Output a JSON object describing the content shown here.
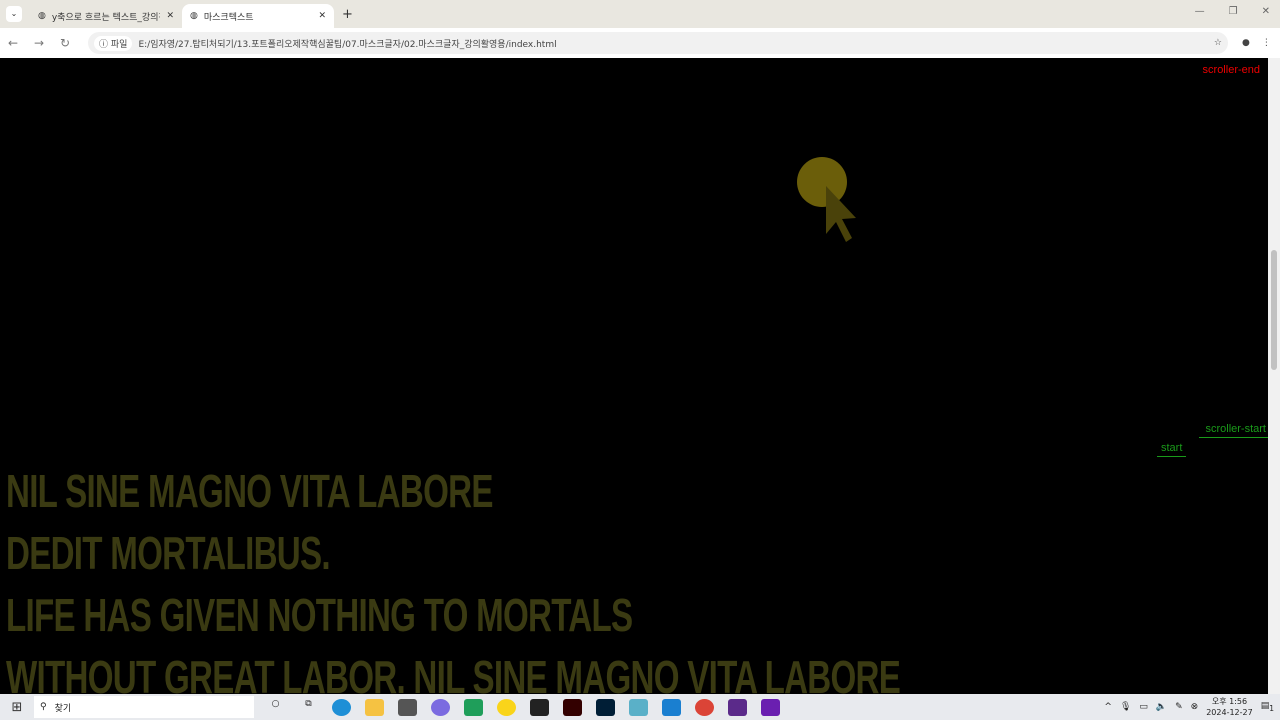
{
  "browser": {
    "tabs": [
      {
        "title": "y축으로 흐르는 텍스트_강의진"
      },
      {
        "title": "마스크텍스트"
      }
    ],
    "url_chip": "파일",
    "url": "E:/임자영/27.탑티처되기/13.포트폴리오제작핵심꿀팁/07.마스크글자/02.마스크글자_강의활영용/index.html"
  },
  "markers": {
    "scroller_end": "scroller-end",
    "scroller_start": "scroller-start",
    "start": "start"
  },
  "text_lines": [
    "NIL SINE MAGNO VITA LABORE",
    "DEDIT MORTALIBUS.",
    "LIFE HAS GIVEN NOTHING TO MORTALS",
    "WITHOUT GREAT LABOR. NIL SINE MAGNO VITA LABORE"
  ],
  "taskbar": {
    "search_placeholder": "찾기",
    "time": "오후 1:56",
    "date": "2024-12-27",
    "notifications": "1"
  },
  "colors": {
    "text": "#3a3a12",
    "cursor": "#6b5e0a",
    "start_marker": "#1a9a1a",
    "end_marker": "#e00000"
  }
}
